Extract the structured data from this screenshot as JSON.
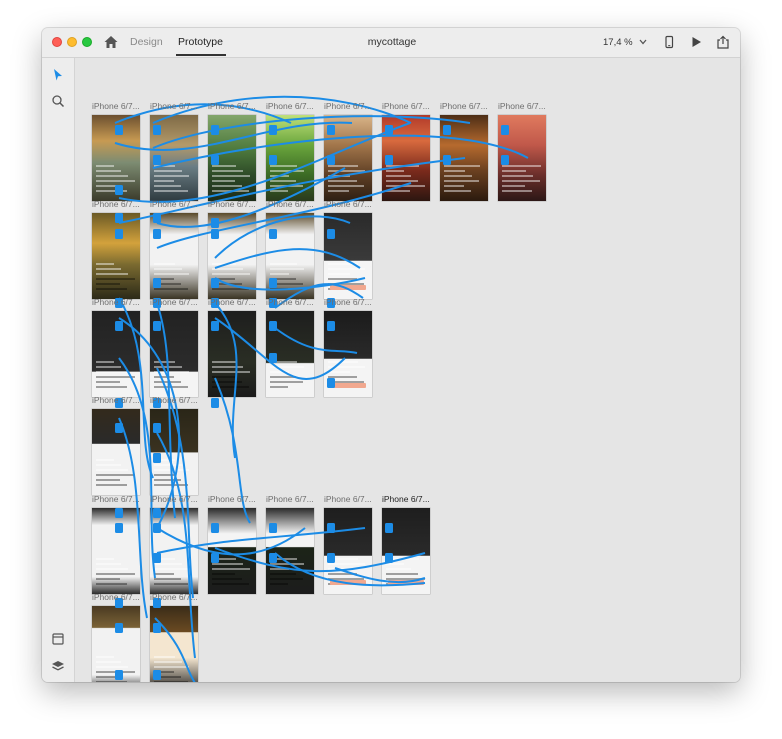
{
  "window": {
    "tabs": {
      "design": "Design",
      "prototype": "Prototype"
    },
    "document_title": "mycottage",
    "zoom_level": "17,4 %"
  },
  "icons": {
    "home": "home-icon",
    "zoom_dropdown": "chevron-down-icon",
    "device_preview": "phone-icon",
    "play": "play-icon",
    "share": "share-icon",
    "select_tool": "arrow-pointer-icon",
    "search_tool": "search-icon",
    "assets": "assets-panel-icon",
    "layers": "layers-icon"
  },
  "colors": {
    "accent": "#1c8ce6",
    "traffic_red": "#fe5f57",
    "traffic_yellow": "#febc2e",
    "traffic_green": "#28c840"
  },
  "artboards": {
    "row1": [
      "iPhone 6/7...",
      "iPhone 6/7...",
      "iPhone 6/7...",
      "iPhone 6/7...",
      "iPhone 6/7...",
      "iPhone 6/7...",
      "iPhone 6/7...",
      "iPhone 6/7..."
    ],
    "row2": [
      "iPhone 6/7...",
      "iPhone 6/7...",
      "iPhone 6/7...",
      "iPhone 6/7...",
      "iPhone 6/7..."
    ],
    "row3": [
      "iPhone 6/7...",
      "iPhone 6/7...",
      "iPhone 6/7...",
      "iPhone 6/7...",
      "iPhone 6/7..."
    ],
    "row4": [
      "iPhone 6/7...",
      "iPhone 6/7..."
    ],
    "row5": [
      "iPhone 6/7...",
      "iPhone 6/7...",
      "iPhone 6/7...",
      "iPhone 6/7...",
      "iPhone 6/7...",
      "iPhone 6/7..."
    ],
    "row6": [
      "iPhone 6/7...",
      "iPhone 6/7..."
    ]
  }
}
